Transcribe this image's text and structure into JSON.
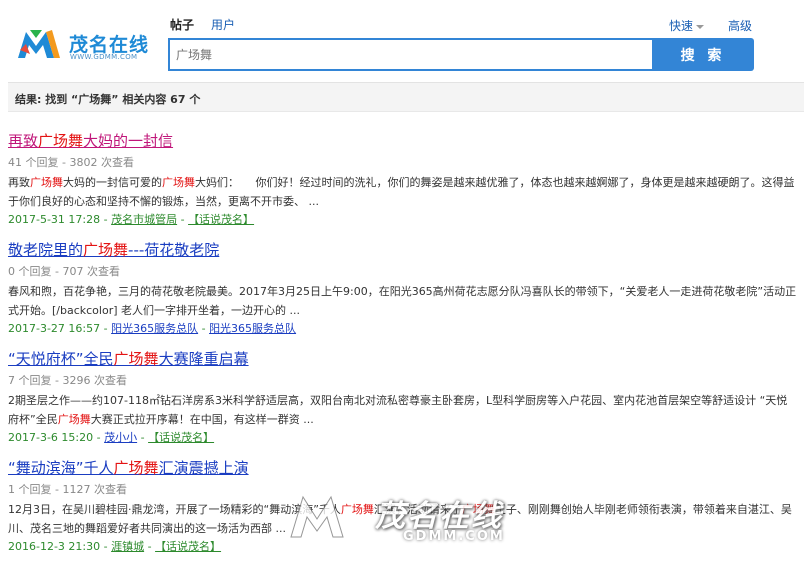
{
  "brand": {
    "name": "茂名在线",
    "sub": "WWW.GDMM.COM"
  },
  "tabs": [
    {
      "label": "帖子",
      "active": true
    },
    {
      "label": "用户",
      "active": false
    }
  ],
  "search": {
    "placeholder": "广场舞",
    "button": "搜 索"
  },
  "quick": {
    "label": "快速"
  },
  "advanced": {
    "label": "高级"
  },
  "summary": {
    "prefix": "结果: 找到 “",
    "keyword": "广场舞",
    "suffix": "” 相关内容 67 个"
  },
  "results": [
    {
      "title": [
        "再致",
        "广场舞",
        "大妈的一封信"
      ],
      "stats": "41 个回复 - 3802 次查看",
      "excerpt": [
        "再致",
        "广场舞",
        "大妈的一封信可爱的",
        "广场舞",
        "大妈们：　　你们好！经过时间的洗礼，你们的舞姿是越来越优雅了，体态也越来越婀娜了，身体更是越来越硬朗了。这得益于你们良好的心态和坚持不懈的锻炼，当然，更离不开市委、 ..."
      ],
      "date": "2017-5-31 17:28",
      "author": "茂名市城管局",
      "forum": "【话说茂名】"
    },
    {
      "title": [
        "敬老院里的",
        "广场舞",
        "---荷花敬老院"
      ],
      "stats": "0 个回复 - 707 次查看",
      "excerpt": [
        "春风和煦，百花争艳，三月的荷花敬老院最美。2017年3月25日上午9:00，在阳光365高州荷花志愿分队冯喜队长的带领下，“关爱老人一走进荷花敬老院”活动正式开始。[/backcolor] 老人们一字排开坐着，一边开心的 ..."
      ],
      "date": "2017-3-27 16:57",
      "author": "阳光365服务总队",
      "forum": "阳光365服务总队"
    },
    {
      "title": [
        "“天悦府杯”全民",
        "广场舞",
        "大赛隆重启幕"
      ],
      "stats": "7 个回复 - 3296 次查看",
      "excerpt": [
        "2期圣层之作——约107-118㎡钻石洋房系3米科学舒适层高，双阳台南北对流私密尊豪主卧套房，L型科学厨房等入户花园、室内花池首层架空等舒适设计 “天悦府杯”全民",
        "广场舞",
        "大赛正式拉开序幕！在中国，有这样一群资 ..."
      ],
      "date": "2017-3-6 15:20",
      "author": "茂小小",
      "forum": "【话说茂名】"
    },
    {
      "title": [
        "“舞动滨海”千人",
        "广场舞",
        "汇演震撼上演"
      ],
      "stats": "1 个回复 - 1127 次查看",
      "excerpt": [
        "12月3日，在吴川碧桂园·鼎龙湾，开展了一场精彩的“舞动滨海”千人",
        "广场舞",
        "汇演，活动请来了",
        "广场舞",
        "王子、刚刚舞创始人毕刚老师领衔表演，带领着来自湛江、吴川、茂名三地的舞蹈爱好者共同演出的这一场活为西部 ..."
      ],
      "date": "2016-12-3 21:30",
      "author": "涯镇城",
      "forum": "【话说茂名】"
    }
  ],
  "watermark": {
    "text": "茂名在线",
    "sub": "GDMM.COM"
  }
}
